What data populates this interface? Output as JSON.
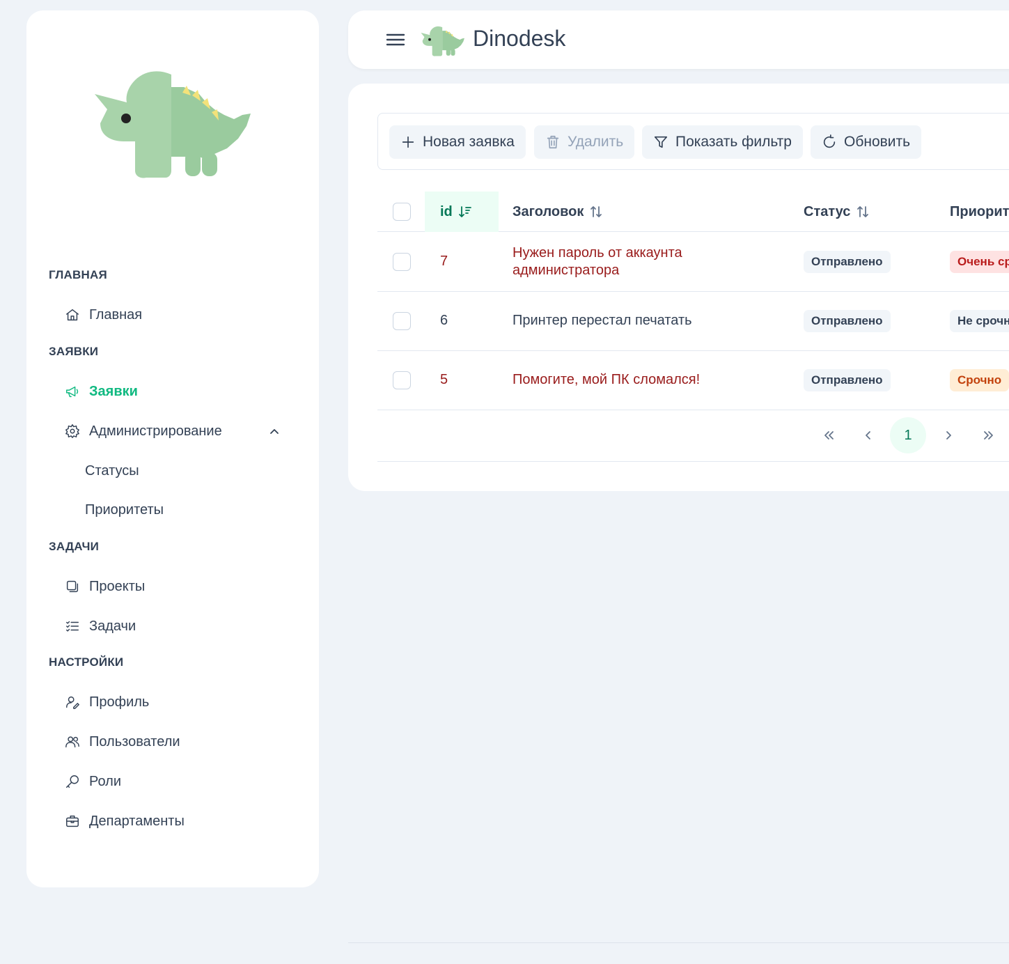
{
  "app": {
    "brand": "Dinodesk"
  },
  "sidebar": {
    "sections": {
      "main": "ГЛАВНАЯ",
      "requests": "ЗАЯВКИ",
      "tasks": "ЗАДАЧИ",
      "settings": "НАСТРОЙКИ"
    },
    "items": {
      "home": "Главная",
      "requests": "Заявки",
      "admin": "Администрирование",
      "statuses": "Статусы",
      "priorities": "Приоритеты",
      "projects": "Проекты",
      "tasks": "Задачи",
      "profile": "Профиль",
      "users": "Пользователи",
      "roles": "Роли",
      "departments": "Департаменты"
    },
    "active": "requests"
  },
  "toolbar": {
    "new": "Новая заявка",
    "delete": "Удалить",
    "filter": "Показать фильтр",
    "refresh": "Обновить"
  },
  "table": {
    "headers": {
      "id": "id",
      "title": "Заголовок",
      "status": "Статус",
      "priority": "Приорит"
    },
    "rows": [
      {
        "id": "7",
        "title_line1": "Нужен пароль от аккаунта",
        "title_line2": "администратора",
        "status": "Отправлено",
        "priority": "Очень ср",
        "priority_color": "red",
        "urgent": true
      },
      {
        "id": "6",
        "title_line1": "Принтер перестал печатать",
        "title_line2": "",
        "status": "Отправлено",
        "priority": "Не срочн",
        "priority_color": "gray",
        "urgent": false
      },
      {
        "id": "5",
        "title_line1": "Помогите, мой ПК сломался!",
        "title_line2": "",
        "status": "Отправлено",
        "priority": "Срочно",
        "priority_color": "orange",
        "urgent": true
      }
    ]
  },
  "pagination": {
    "current": "1"
  },
  "colors": {
    "accent": "#10b981",
    "urgent_text": "#991b1b"
  }
}
